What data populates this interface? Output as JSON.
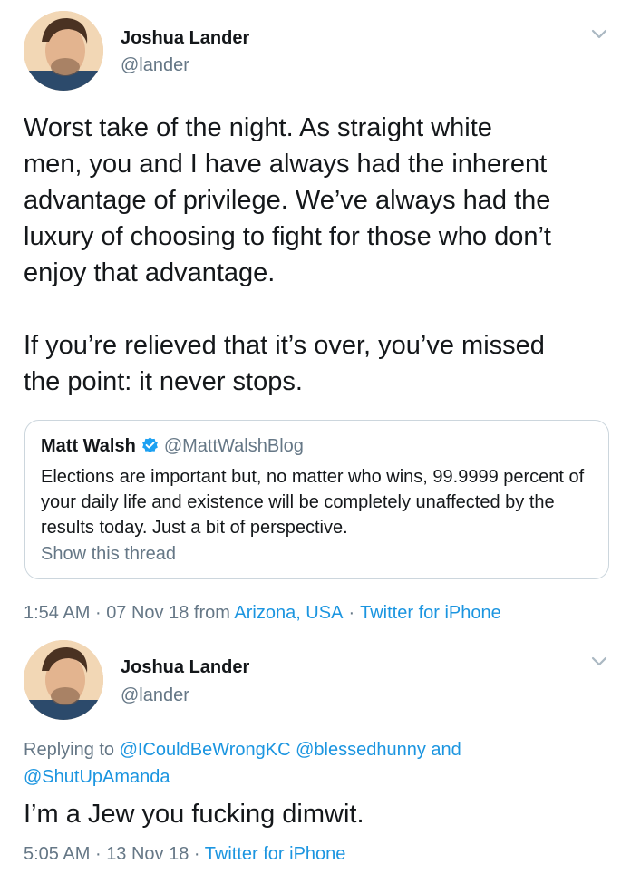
{
  "tweet1": {
    "name": "Joshua Lander",
    "handle": "@lander",
    "body": "Worst take of the night. As straight white\nmen, you and I have always had the inherent\nadvantage of privilege. We’ve always had the\nluxury of choosing to fight for those who don’t\nenjoy that advantage.\n\nIf you’re relieved that it’s over, you’ve missed\nthe point: it never stops.",
    "quote": {
      "name": "Matt Walsh",
      "handle": "@MattWalshBlog",
      "text": "Elections are important but, no matter who wins, 99.9999 percent of your daily life and existence will be completely unaffected by the results today. Just a bit of perspective.",
      "show_thread": "Show this thread"
    },
    "time": "1:54 AM",
    "date": "07 Nov 18",
    "from": "from",
    "location": "Arizona, USA",
    "client": "Twitter for iPhone",
    "sep": "·"
  },
  "tweet2": {
    "name": "Joshua Lander",
    "handle": "@lander",
    "replying_to": "Replying to",
    "mention1": "@ICouldBeWrongKC",
    "mention2": "@blessedhunny",
    "and": "and",
    "mention3": "@ShutUpAmanda",
    "body": "I’m a Jew you fucking dimwit.",
    "time": "5:05 AM",
    "date": "13 Nov 18",
    "client": "Twitter for iPhone",
    "sep": "·"
  },
  "icons": {
    "chevron": "chevron-down-icon",
    "verified": "verified-badge-icon",
    "avatar": "avatar"
  },
  "colors": {
    "link": "#1b95e0",
    "secondary": "#657786",
    "text": "#14171a",
    "border": "#ccd6dd"
  }
}
